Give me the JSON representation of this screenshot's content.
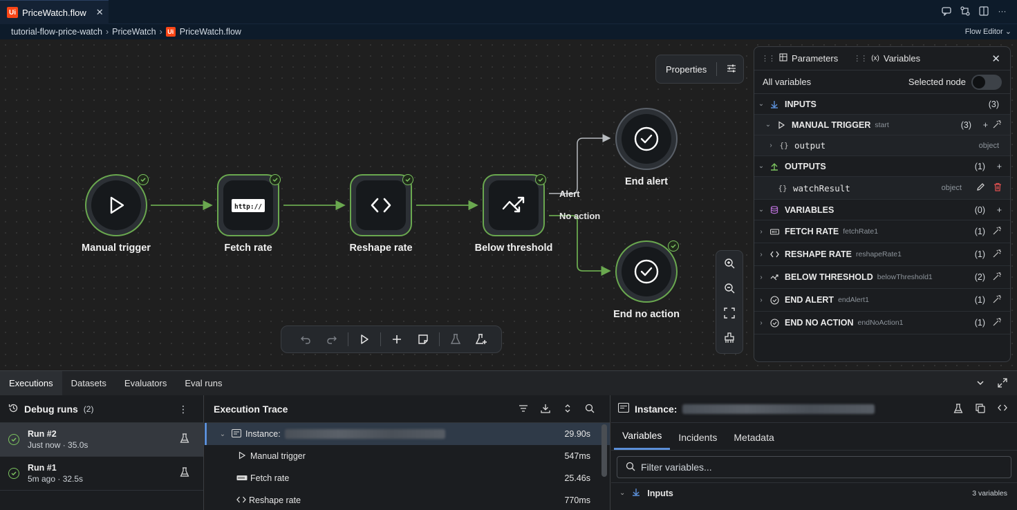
{
  "tab": {
    "logo": "Ui",
    "label": "PriceWatch.flow"
  },
  "breadcrumb": {
    "items": [
      "tutorial-flow-price-watch",
      "PriceWatch",
      "PriceWatch.flow"
    ],
    "mode": "Flow Editor"
  },
  "canvas": {
    "properties_label": "Properties",
    "nodes": [
      {
        "label": "Manual trigger",
        "icon": "play-icon"
      },
      {
        "label": "Fetch rate",
        "icon": "http-icon",
        "badge": "http://"
      },
      {
        "label": "Reshape rate",
        "icon": "code-icon"
      },
      {
        "label": "Below threshold",
        "icon": "decision-icon"
      },
      {
        "label": "End alert",
        "icon": "check-circle-icon"
      },
      {
        "label": "End no action",
        "icon": "check-circle-icon"
      }
    ],
    "edge_labels": {
      "alert": "Alert",
      "no_action": "No action"
    }
  },
  "vars_panel": {
    "tabs": [
      "Parameters",
      "Variables"
    ],
    "all_variables": "All variables",
    "selected_node": "Selected node",
    "rows": [
      {
        "name": "INPUTS",
        "count": "(3)"
      },
      {
        "name": "MANUAL TRIGGER",
        "sub": "start",
        "count": "(3)"
      },
      {
        "name": "output",
        "type": "object"
      },
      {
        "name": "OUTPUTS",
        "count": "(1)"
      },
      {
        "name": "watchResult",
        "type": "object"
      },
      {
        "name": "VARIABLES",
        "count": "(0)"
      },
      {
        "name": "FETCH RATE",
        "sub": "fetchRate1",
        "count": "(1)"
      },
      {
        "name": "RESHAPE RATE",
        "sub": "reshapeRate1",
        "count": "(1)"
      },
      {
        "name": "BELOW THRESHOLD",
        "sub": "belowThreshold1",
        "count": "(2)"
      },
      {
        "name": "END ALERT",
        "sub": "endAlert1",
        "count": "(1)"
      },
      {
        "name": "END NO ACTION",
        "sub": "endNoAction1",
        "count": "(1)"
      }
    ]
  },
  "bottom": {
    "tabs": [
      "Executions",
      "Datasets",
      "Evaluators",
      "Eval runs"
    ],
    "runs": {
      "title": "Debug runs",
      "count": "(2)",
      "items": [
        {
          "title": "Run #2",
          "meta": "Just now · 35.0s"
        },
        {
          "title": "Run #1",
          "meta": "5m ago · 32.5s"
        }
      ]
    },
    "trace": {
      "title": "Execution Trace",
      "rows": [
        {
          "label": "Instance:",
          "duration": "29.90s"
        },
        {
          "label": "Manual trigger",
          "duration": "547ms"
        },
        {
          "label": "Fetch rate",
          "duration": "25.46s"
        },
        {
          "label": "Reshape rate",
          "duration": "770ms"
        }
      ]
    },
    "instance": {
      "title": "Instance:",
      "tabs": [
        "Variables",
        "Incidents",
        "Metadata"
      ],
      "filter_placeholder": "Filter variables...",
      "inputs_label": "Inputs",
      "inputs_count": "3 variables"
    }
  },
  "colors": {
    "node_border": "#6aa84f",
    "accent": "#5b8fd8",
    "brand": "#fa4616",
    "delete": "#e05050"
  }
}
